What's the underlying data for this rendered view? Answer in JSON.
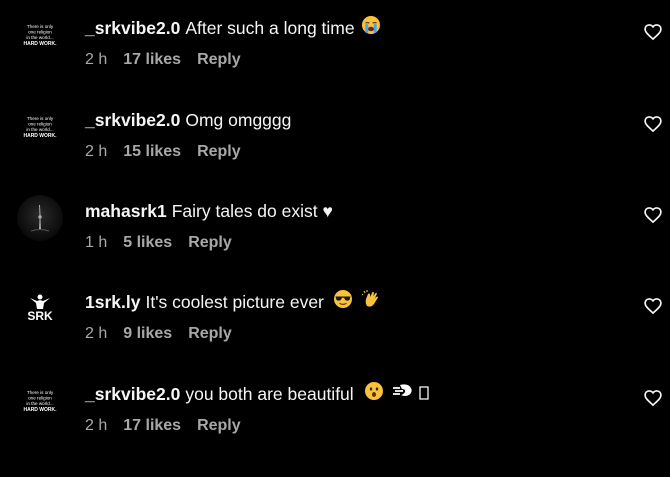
{
  "accent_colors": {
    "text": "#f5f5f5",
    "meta": "#a8a8a8",
    "background": "#000000"
  },
  "avatar_texts": {
    "srkvibe": [
      "There is only",
      "one religion",
      "in the world...",
      "HARD WORK."
    ],
    "srkly": "SRK"
  },
  "comments": [
    {
      "username": "_srkvibe2.0",
      "text": "After such a long time",
      "emojis": [
        "loudly-crying-face-icon"
      ],
      "time": "2 h",
      "likes": "17 likes",
      "reply": "Reply",
      "avatar": "srkvibe-avatar"
    },
    {
      "username": "_srkvibe2.0",
      "text": "Omg omgggg",
      "emojis": [],
      "time": "2 h",
      "likes": "15 likes",
      "reply": "Reply",
      "avatar": "srkvibe-avatar"
    },
    {
      "username": "mahasrk1",
      "text": "Fairy tales do exist ♥",
      "emojis": [],
      "time": "1 h",
      "likes": "5 likes",
      "reply": "Reply",
      "avatar": "dark-silhouette-avatar"
    },
    {
      "username": "1srk.ly",
      "text": "It's coolest picture ever",
      "emojis": [
        "sunglasses-face-icon",
        "clapping-hands-icon"
      ],
      "time": "2 h",
      "likes": "9 likes",
      "reply": "Reply",
      "avatar": "srk-logo-avatar"
    },
    {
      "username": "_srkvibe2.0",
      "text": "you both are beautiful",
      "emojis": [
        "astonished-face-icon",
        "dashing-away-icon",
        "unknown-glyph-box-icon"
      ],
      "time": "2 h",
      "likes": "17 likes",
      "reply": "Reply",
      "avatar": "srkvibe-avatar"
    }
  ],
  "icons": {
    "like": "heart-outline-icon"
  }
}
